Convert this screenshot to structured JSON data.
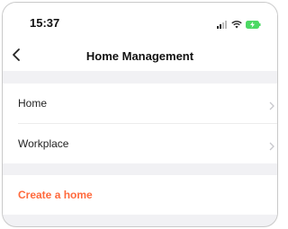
{
  "status_bar": {
    "time": "15:37",
    "icons": [
      "signal-icon",
      "wifi-icon",
      "battery-charging-icon"
    ],
    "battery_color": "#4cd964"
  },
  "nav": {
    "title": "Home Management",
    "back_icon": "chevron-left-icon"
  },
  "homes": {
    "items": [
      {
        "label": "Home"
      },
      {
        "label": "Workplace"
      }
    ]
  },
  "actions": {
    "create_label": "Create a home",
    "accent_color": "#ff6a3d"
  }
}
